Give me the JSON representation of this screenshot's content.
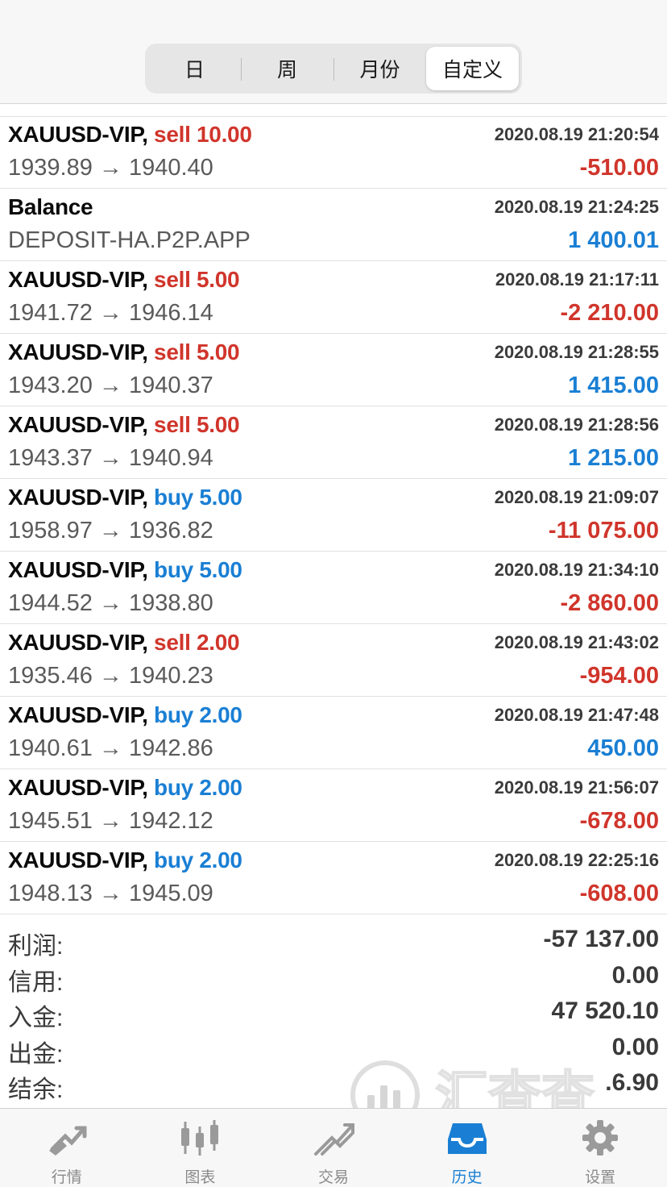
{
  "periods": {
    "items": [
      "日",
      "周",
      "月份",
      "自定义"
    ],
    "selected": "自定义"
  },
  "deals": [
    {
      "symbol": "XAUUSD-VIP,",
      "side": "sell",
      "volume": "sell 10.00",
      "time": "2020.08.19 21:20:54",
      "prices": "1939.89 → 1940.40",
      "profit": "-510.00",
      "profit_sign": "neg"
    },
    {
      "symbol": "Balance",
      "side": "",
      "volume": "",
      "time": "2020.08.19 21:24:25",
      "prices": "DEPOSIT-HA.P2P.APP",
      "profit": "1 400.01",
      "profit_sign": "pos"
    },
    {
      "symbol": "XAUUSD-VIP,",
      "side": "sell",
      "volume": "sell 5.00",
      "time": "2020.08.19 21:17:11",
      "prices": "1941.72 → 1946.14",
      "profit": "-2 210.00",
      "profit_sign": "neg"
    },
    {
      "symbol": "XAUUSD-VIP,",
      "side": "sell",
      "volume": "sell 5.00",
      "time": "2020.08.19 21:28:55",
      "prices": "1943.20 → 1940.37",
      "profit": "1 415.00",
      "profit_sign": "pos"
    },
    {
      "symbol": "XAUUSD-VIP,",
      "side": "sell",
      "volume": "sell 5.00",
      "time": "2020.08.19 21:28:56",
      "prices": "1943.37 → 1940.94",
      "profit": "1 215.00",
      "profit_sign": "pos"
    },
    {
      "symbol": "XAUUSD-VIP,",
      "side": "buy",
      "volume": "buy 5.00",
      "time": "2020.08.19 21:09:07",
      "prices": "1958.97 → 1936.82",
      "profit": "-11 075.00",
      "profit_sign": "neg"
    },
    {
      "symbol": "XAUUSD-VIP,",
      "side": "buy",
      "volume": "buy 5.00",
      "time": "2020.08.19 21:34:10",
      "prices": "1944.52 → 1938.80",
      "profit": "-2 860.00",
      "profit_sign": "neg"
    },
    {
      "symbol": "XAUUSD-VIP,",
      "side": "sell",
      "volume": "sell 2.00",
      "time": "2020.08.19 21:43:02",
      "prices": "1935.46 → 1940.23",
      "profit": "-954.00",
      "profit_sign": "neg"
    },
    {
      "symbol": "XAUUSD-VIP,",
      "side": "buy",
      "volume": "buy 2.00",
      "time": "2020.08.19 21:47:48",
      "prices": "1940.61 → 1942.86",
      "profit": "450.00",
      "profit_sign": "pos"
    },
    {
      "symbol": "XAUUSD-VIP,",
      "side": "buy",
      "volume": "buy 2.00",
      "time": "2020.08.19 21:56:07",
      "prices": "1945.51 → 1942.12",
      "profit": "-678.00",
      "profit_sign": "neg"
    },
    {
      "symbol": "XAUUSD-VIP,",
      "side": "buy",
      "volume": "buy 2.00",
      "time": "2020.08.19 22:25:16",
      "prices": "1948.13 → 1945.09",
      "profit": "-608.00",
      "profit_sign": "neg"
    }
  ],
  "summary": {
    "profit_label": "利润:",
    "profit_value": "-57 137.00",
    "credit_label": "信用:",
    "credit_value": "0.00",
    "deposit_label": "入金:",
    "deposit_value": "47 520.10",
    "withdrawal_label": "出金:",
    "withdrawal_value": "0.00",
    "balance_label": "结余:",
    "balance_value": ".6.90"
  },
  "watermark": {
    "text": "汇查查"
  },
  "tabbar": {
    "items": [
      {
        "label": "行情",
        "icon": "quotes-icon"
      },
      {
        "label": "图表",
        "icon": "chart-candles-icon"
      },
      {
        "label": "交易",
        "icon": "trade-icon"
      },
      {
        "label": "历史",
        "icon": "history-inbox-icon"
      },
      {
        "label": "设置",
        "icon": "gear-icon"
      }
    ],
    "active": "历史"
  },
  "colors": {
    "sell": "#d0352b",
    "buy": "#1a7fd4",
    "negative": "#d0352b",
    "positive": "#1a7fd4",
    "active_tab": "#1a7fd4"
  }
}
